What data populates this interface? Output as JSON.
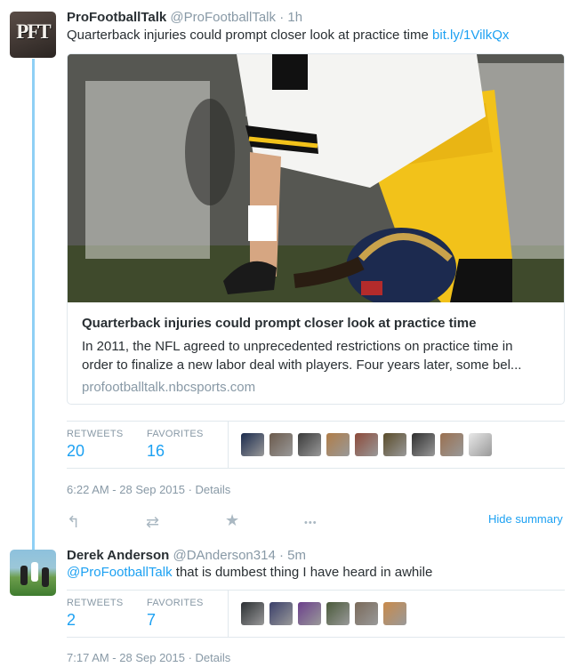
{
  "tweet1": {
    "author_name": "ProFootballTalk",
    "handle": "@ProFootballTalk",
    "separator": "·",
    "time": "1h",
    "avatar_text": "PFT",
    "text": "Quarterback injuries could prompt closer look at practice time",
    "link": "bit.ly/1VilkQx",
    "card": {
      "title": "Quarterback injuries could prompt closer look at practice time",
      "description_line1": "In 2011, the NFL agreed to unprecedented restrictions on practice time in",
      "description_line2": "order to finalize a new labor deal with players. Four years later, some bel...",
      "domain": "profootballtalk.nbcsports.com"
    },
    "stats": {
      "retweets_label": "RETWEETS",
      "retweets": "20",
      "favorites_label": "FAVORITES",
      "favorites": "16"
    },
    "favoriters": [
      {
        "name": "avatar-texans",
        "color": "#1a2a4d"
      },
      {
        "name": "avatar-user-2",
        "color": "#6b5a4c"
      },
      {
        "name": "avatar-user-3",
        "color": "#3a3a3a"
      },
      {
        "name": "avatar-user-4",
        "color": "#b07d48"
      },
      {
        "name": "avatar-user-5",
        "color": "#8c4a3a"
      },
      {
        "name": "avatar-user-6",
        "color": "#5a4c2a"
      },
      {
        "name": "avatar-user-7",
        "color": "#2f2f2f"
      },
      {
        "name": "avatar-user-8",
        "color": "#9a7050"
      },
      {
        "name": "avatar-user-9",
        "color": "#e8e8e8"
      }
    ],
    "timestamp": "6:22 AM - 28 Sep 2015",
    "details_label": "Details",
    "hide_summary": "Hide summary",
    "actions": {
      "reply": "↰",
      "retweet": "⇄",
      "favorite": "★",
      "more": "•••"
    }
  },
  "tweet2": {
    "author_name": "Derek Anderson",
    "handle": "@DAnderson314",
    "separator": "·",
    "time": "5m",
    "mention": "@ProFootballTalk",
    "text": " that is dumbest thing I have heard in awhile",
    "stats": {
      "retweets_label": "RETWEETS",
      "retweets": "2",
      "favorites_label": "FAVORITES",
      "favorites": "7"
    },
    "favoriters": [
      {
        "name": "avatar-panthers",
        "color": "#2b2f33"
      },
      {
        "name": "avatar-user-b",
        "color": "#3a3f6a"
      },
      {
        "name": "avatar-user-c",
        "color": "#6b3f8c"
      },
      {
        "name": "avatar-user-d",
        "color": "#4a5a3a"
      },
      {
        "name": "avatar-user-e",
        "color": "#7a6a5a"
      },
      {
        "name": "avatar-user-f",
        "color": "#c98a4a"
      }
    ],
    "timestamp": "7:17 AM - 28 Sep 2015",
    "details_label": "Details"
  }
}
